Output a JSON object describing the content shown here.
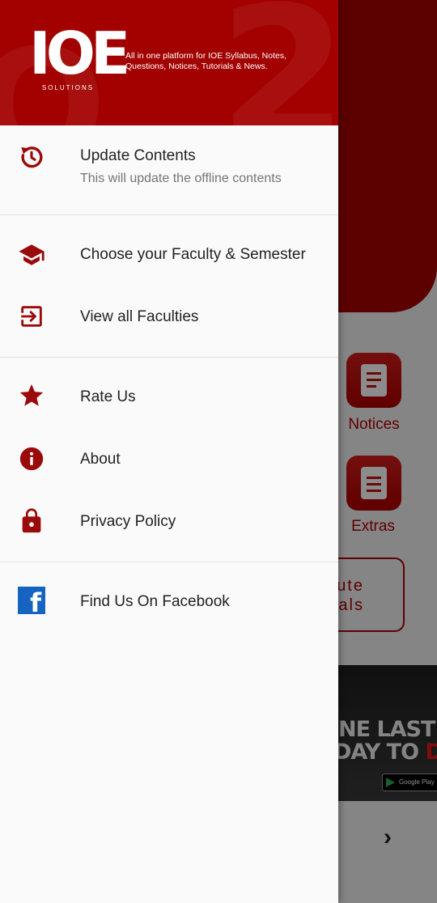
{
  "app": {
    "logo_text": "IOE",
    "logo_subtext": "SOLUTIONS",
    "tagline": "All in one platform for IOE Syllabus, Notes, Questions, Notices, Tutorials & News."
  },
  "drawer": {
    "update": {
      "label": "Update Contents",
      "subtitle": "This will update the offline contents",
      "icon": "refresh-clock-icon"
    },
    "choose": {
      "label": "Choose your Faculty & Semester",
      "icon": "graduation-cap-icon"
    },
    "faculties": {
      "label": "View all Faculties",
      "icon": "exit-arrow-icon"
    },
    "rate": {
      "label": "Rate Us",
      "icon": "star-icon"
    },
    "about": {
      "label": "About",
      "icon": "info-icon"
    },
    "privacy": {
      "label": "Privacy Policy",
      "icon": "lock-icon"
    },
    "facebook": {
      "label": "Find Us On Facebook",
      "icon": "facebook-icon"
    }
  },
  "background": {
    "tiles": [
      {
        "label": "Notices",
        "icon": "notice-board-icon"
      },
      {
        "label": "Extras",
        "icon": "clipboard-icon"
      }
    ],
    "button_line1": "ute",
    "button_line2": "als",
    "ad": {
      "line1_white": "NE LAST",
      "line2_white": "DAY TO ",
      "line2_red": "DIE",
      "store": "Google Play"
    }
  },
  "colors": {
    "primary": "#a30000",
    "icon": "#9b0a0a",
    "facebook": "#1565c0"
  }
}
